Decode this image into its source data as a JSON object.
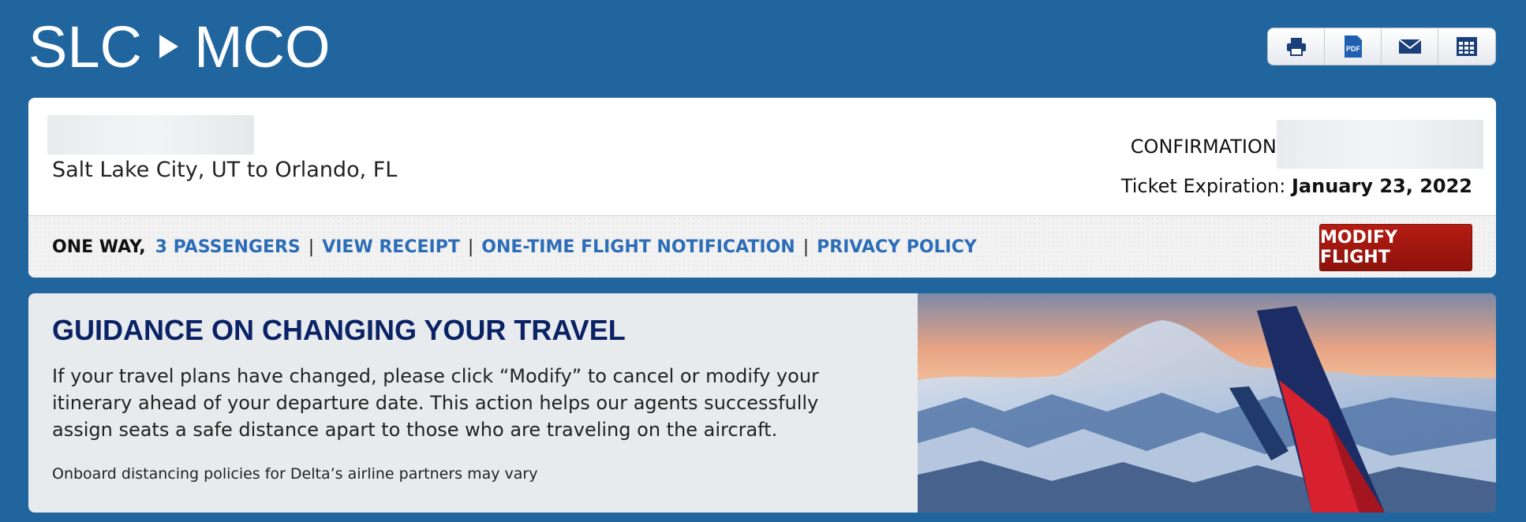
{
  "header": {
    "origin": "SLC",
    "destination": "MCO"
  },
  "toolbar": {
    "print_icon": "print-icon",
    "pdf_icon": "pdf-icon",
    "email_icon": "email-icon",
    "calendar_icon": "calendar-icon",
    "pdf_label": "PDF"
  },
  "trip": {
    "route_text": "Salt Lake City, UT to Orlando, FL",
    "confirmation_label": "CONFIRMATION#:",
    "expiration_label": "Ticket Expiration:",
    "expiration_date": "January 23, 2022"
  },
  "actions": {
    "trip_type": "ONE WAY,",
    "passengers": "3 PASSENGERS",
    "separator": "|",
    "view_receipt": "VIEW RECEIPT",
    "notification": "ONE-TIME FLIGHT NOTIFICATION",
    "privacy": "PRIVACY POLICY",
    "modify": "MODIFY FLIGHT"
  },
  "guidance": {
    "title": "GUIDANCE ON CHANGING YOUR TRAVEL",
    "body": "If your travel plans have changed, please click “Modify” to cancel or modify your itinerary ahead of your departure date. This action helps our agents successfully assign seats a safe distance apart to those who are traveling on the aircraft.",
    "note": "Onboard distancing policies for Delta’s airline partners may vary"
  },
  "colors": {
    "background": "#21659f",
    "link": "#2c6db8",
    "modify_button": "#a3180f",
    "title": "#0a2266"
  }
}
